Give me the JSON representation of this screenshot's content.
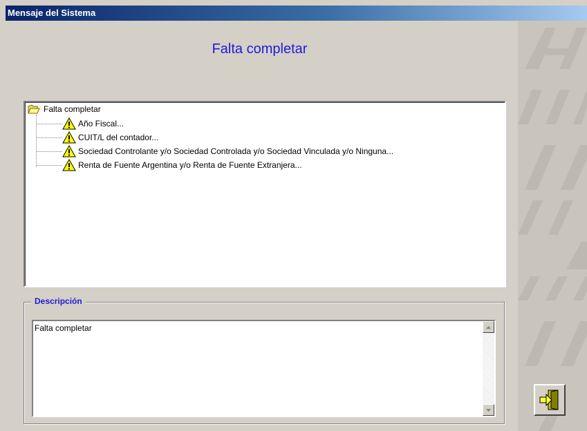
{
  "window": {
    "title": "Mensaje del Sistema"
  },
  "heading": "Falta completar",
  "tree": {
    "root": {
      "label": "Falta completar",
      "icon": "folder-open-icon"
    },
    "items": [
      {
        "label": "Año Fiscal...",
        "icon": "warning-icon"
      },
      {
        "label": "CUIT/L del contador...",
        "icon": "warning-icon"
      },
      {
        "label": "Sociedad Controlante y/o Sociedad Controlada y/o Sociedad Vinculada y/o Ninguna...",
        "icon": "warning-icon"
      },
      {
        "label": "Renta de Fuente Argentina y/o Renta de Fuente Extranjera...",
        "icon": "warning-icon"
      }
    ]
  },
  "description": {
    "legend": "Descripción",
    "text": "Falta completar"
  },
  "exit_button": {
    "icon": "exit-door-icon"
  },
  "watermark": {
    "text": "AFIP"
  },
  "colors": {
    "accent_text": "#1c1cd6",
    "titlebar_start": "#0a246a",
    "titlebar_end": "#a6caf0",
    "warning_yellow": "#ffff00"
  }
}
